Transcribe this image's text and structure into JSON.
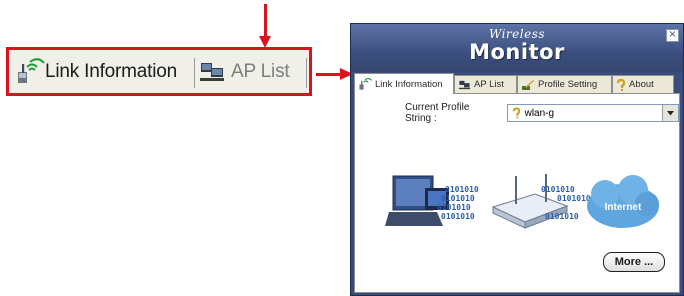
{
  "zoom_callout": {
    "tabs": [
      {
        "label": "Link Information",
        "icon": "link-information-icon"
      },
      {
        "label": "AP List",
        "icon": "ap-list-icon"
      }
    ]
  },
  "window": {
    "title_small": "Wireless",
    "title_big": "Monitor",
    "close_glyph": "×",
    "tabs": [
      {
        "label": "Link Information",
        "icon": "link-information-icon",
        "active": true
      },
      {
        "label": "AP List",
        "icon": "ap-list-icon",
        "active": false
      },
      {
        "label": "Profile Setting",
        "icon": "profile-setting-icon",
        "active": false
      },
      {
        "label": "About",
        "icon": "about-icon",
        "active": false
      }
    ],
    "profile": {
      "label": "Current Profile String :",
      "value": "wlan-g",
      "icon": "profile-key-icon"
    },
    "illustration": {
      "binary_text": "0101010",
      "cloud_label": "Internet"
    },
    "more_button": "More ..."
  },
  "colors": {
    "annotation_red": "#d9121b",
    "window_blue": "#3a4d7a",
    "cloud_blue": "#5fa6de"
  }
}
